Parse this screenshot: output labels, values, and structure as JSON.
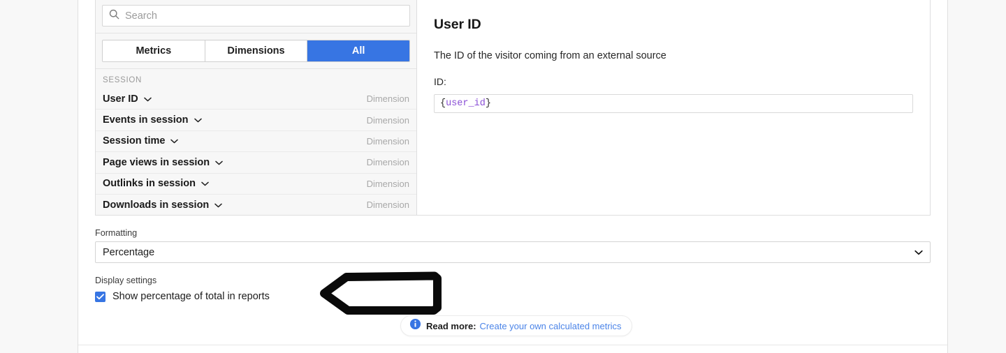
{
  "search": {
    "placeholder": "Search",
    "value": "",
    "icon": "search-icon"
  },
  "tabs": [
    {
      "label": "Metrics",
      "active": false
    },
    {
      "label": "Dimensions",
      "active": false
    },
    {
      "label": "All",
      "active": true
    }
  ],
  "list": {
    "group_label": "SESSION",
    "rows": [
      {
        "name": "User ID",
        "type": "Dimension"
      },
      {
        "name": "Events in session",
        "type": "Dimension"
      },
      {
        "name": "Session time",
        "type": "Dimension"
      },
      {
        "name": "Page views in session",
        "type": "Dimension"
      },
      {
        "name": "Outlinks in session",
        "type": "Dimension"
      },
      {
        "name": "Downloads in session",
        "type": "Dimension"
      }
    ]
  },
  "detail": {
    "title": "User ID",
    "description": "The ID of the visitor coming from an external source",
    "field_label": "ID:",
    "token_open": "{",
    "token_var": "user_id",
    "token_close": "}"
  },
  "formatting": {
    "caption": "Formatting",
    "selected": "Percentage",
    "options": [
      "Percentage"
    ]
  },
  "display_settings": {
    "caption": "Display settings",
    "checkbox_label": "Show percentage of total in reports",
    "checked": true
  },
  "footer": {
    "icon": "info-icon",
    "label": "Read more:",
    "link_text": "Create your own calculated metrics"
  },
  "annotation": {
    "shape": "left-arrow-outline",
    "color": "#000000"
  },
  "colors": {
    "accent_blue": "#3775e3",
    "link_blue": "#4b84e8",
    "token_purple": "#8a4fd6",
    "muted_gray": "#a8a8a8",
    "page_bg": "#ffffff",
    "gutter_bg": "#f8f8f8"
  }
}
